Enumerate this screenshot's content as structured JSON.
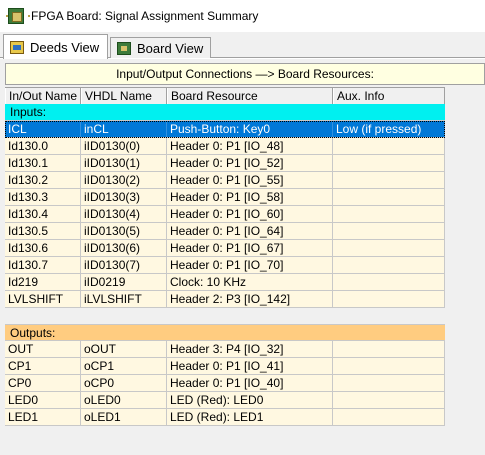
{
  "window": {
    "title": "FPGA Board: Signal Assignment Summary",
    "icon": "fpga-board-icon"
  },
  "tabs": [
    {
      "label": "Deeds View",
      "icon": "deeds-view-icon",
      "active": true
    },
    {
      "label": "Board View",
      "icon": "board-view-icon",
      "active": false
    }
  ],
  "banner": "Input/Output Connections —> Board Resources:",
  "columns": [
    "In/Out Name",
    "VHDL Name",
    "Board Resource",
    "Aux. Info"
  ],
  "sections": {
    "inputs_label": "Inputs:",
    "outputs_label": "Outputs:"
  },
  "inputs": [
    {
      "name": "ICL",
      "vhdl": "inCL",
      "resource": "Push-Button: Key0",
      "aux": "Low (if pressed)",
      "selected": true
    },
    {
      "name": "Id130.0",
      "vhdl": "iID0130(0)",
      "resource": "Header 0: P1 [IO_48]",
      "aux": ""
    },
    {
      "name": "Id130.1",
      "vhdl": "iID0130(1)",
      "resource": "Header 0: P1 [IO_52]",
      "aux": ""
    },
    {
      "name": "Id130.2",
      "vhdl": "iID0130(2)",
      "resource": "Header 0: P1 [IO_55]",
      "aux": ""
    },
    {
      "name": "Id130.3",
      "vhdl": "iID0130(3)",
      "resource": "Header 0: P1 [IO_58]",
      "aux": ""
    },
    {
      "name": "Id130.4",
      "vhdl": "iID0130(4)",
      "resource": "Header 0: P1 [IO_60]",
      "aux": ""
    },
    {
      "name": "Id130.5",
      "vhdl": "iID0130(5)",
      "resource": "Header 0: P1 [IO_64]",
      "aux": ""
    },
    {
      "name": "Id130.6",
      "vhdl": "iID0130(6)",
      "resource": "Header 0: P1 [IO_67]",
      "aux": ""
    },
    {
      "name": "Id130.7",
      "vhdl": "iID0130(7)",
      "resource": "Header 0: P1 [IO_70]",
      "aux": ""
    },
    {
      "name": "Id219",
      "vhdl": "iID0219",
      "resource": "Clock: 10 KHz",
      "aux": ""
    },
    {
      "name": "LVLSHIFT",
      "vhdl": "iLVLSHIFT",
      "resource": "Header 2: P3 [IO_142]",
      "aux": ""
    }
  ],
  "outputs": [
    {
      "name": "OUT",
      "vhdl": "oOUT",
      "resource": "Header 3: P4 [IO_32]",
      "aux": ""
    },
    {
      "name": "CP1",
      "vhdl": "oCP1",
      "resource": "Header 0: P1 [IO_41]",
      "aux": ""
    },
    {
      "name": "CP0",
      "vhdl": "oCP0",
      "resource": "Header 0: P1 [IO_40]",
      "aux": ""
    },
    {
      "name": "LED0",
      "vhdl": "oLED0",
      "resource": "LED (Red): LED0",
      "aux": ""
    },
    {
      "name": "LED1",
      "vhdl": "oLED1",
      "resource": "LED (Red): LED1",
      "aux": ""
    }
  ],
  "colors": {
    "inputs_band": "#00f0f0",
    "outputs_band": "#ffcc80",
    "selection": "#0078d7",
    "row_background": "#fff8e1",
    "banner_background": "#ffffe1"
  }
}
